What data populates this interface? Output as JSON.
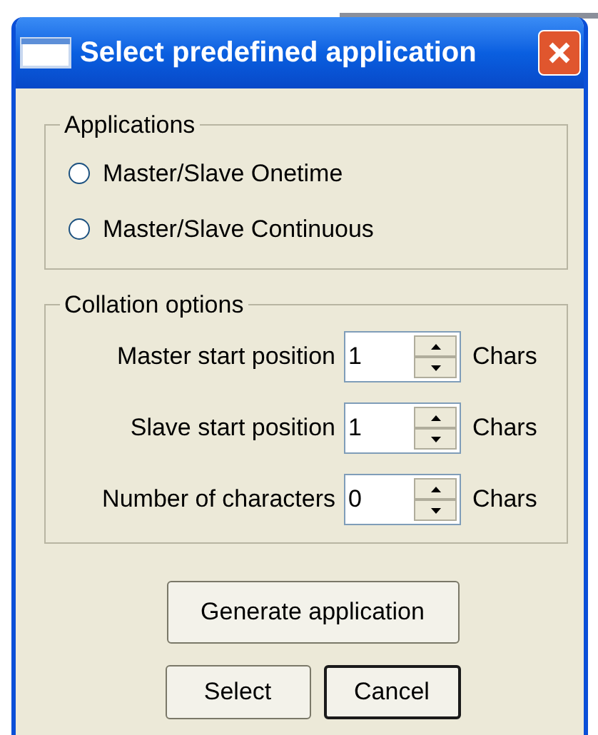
{
  "window": {
    "title": "Select predefined application"
  },
  "applications": {
    "label": "Applications",
    "options": [
      {
        "label": "Master/Slave Onetime",
        "selected": false
      },
      {
        "label": "Master/Slave Continuous",
        "selected": false
      }
    ]
  },
  "collation_options": {
    "label": "Collation options",
    "fields": [
      {
        "label": "Master start position",
        "value": "1",
        "unit": "Chars"
      },
      {
        "label": "Slave start position",
        "value": "1",
        "unit": "Chars"
      },
      {
        "label": "Number of characters",
        "value": "0",
        "unit": "Chars"
      }
    ]
  },
  "generate_button": {
    "label": "Generate application",
    "default": false
  },
  "buttons": [
    {
      "label": "Select",
      "default": false
    },
    {
      "label": "Cancel",
      "default": true
    }
  ]
}
